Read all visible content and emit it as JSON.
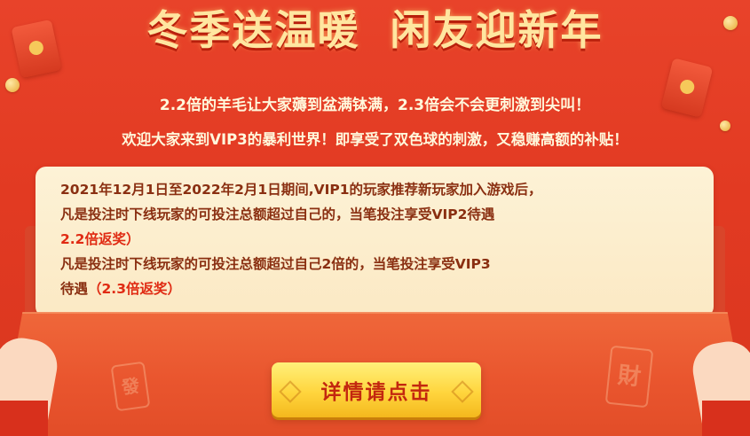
{
  "banner": {
    "title_part1": "冬季送温暖",
    "title_part2": "闲友迎新年",
    "subtitle_line1": "2.2倍的羊毛让大家薅到盆满钵满，2.3倍会不会更刺激到尖叫！",
    "subtitle_line2": "欢迎大家来到VIP3的暴利世界！即享受了双色球的刺激，又稳赚高额的补贴！"
  },
  "card": {
    "line1": "2021年12月1日至2022年2月1日期间,VIP1的玩家推荐新玩家加入游戏后，",
    "line2": "凡是投注时下线玩家的可投注总额超过自己的，当笔投注享受VIP2待遇",
    "line3": "2.2倍返奖）",
    "line4": "凡是投注时下线玩家的可投注总额超过自己2倍的，当笔投注享受VIP3",
    "line5": "待遇（2.3倍返奖）"
  },
  "envelope": {
    "stamp_left": "發",
    "stamp_right": "財"
  },
  "cta": {
    "label": "详情请点击"
  },
  "colors": {
    "background_red": "#e23a22",
    "title_gold": "#ffe6a0",
    "card_cream": "#fdf2d6",
    "card_text": "#8a2f11",
    "accent_red": "#e02b13",
    "button_yellow": "#ffd53d"
  }
}
